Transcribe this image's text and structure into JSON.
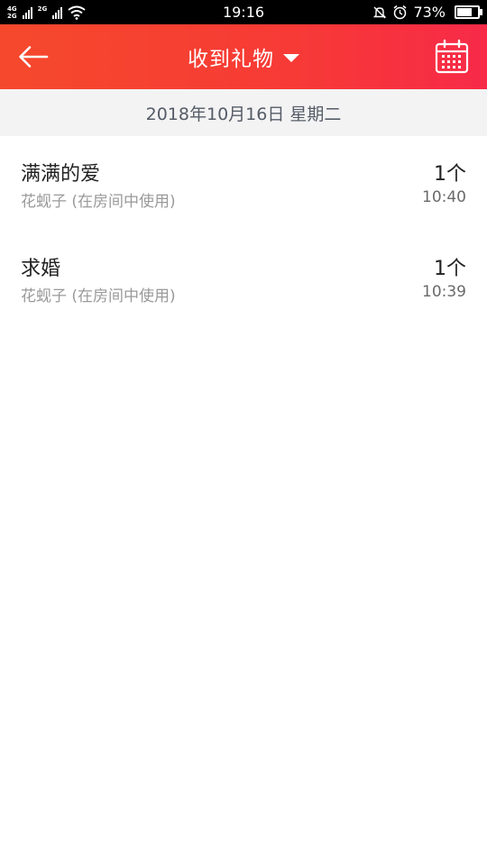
{
  "status_bar": {
    "network_top": "4G",
    "network_bottom": "2G",
    "network_secondary": "2G",
    "time": "19:16",
    "battery_percent_text": "73%",
    "battery_level": 0.73,
    "icons": [
      "signal-icon",
      "wifi-icon",
      "mute-icon",
      "alarm-icon",
      "battery-icon"
    ]
  },
  "header": {
    "title": "收到礼物",
    "icons": [
      "back-arrow-icon",
      "dropdown-caret-icon",
      "calendar-icon"
    ]
  },
  "date_bar": {
    "text": "2018年10月16日 星期二"
  },
  "gifts": [
    {
      "name": "满满的爱",
      "sender": "花蚬子 (在房间中使用)",
      "count": "1个",
      "time": "10:40"
    },
    {
      "name": "求婚",
      "sender": "花蚬子 (在房间中使用)",
      "count": "1个",
      "time": "10:39"
    }
  ],
  "colors": {
    "header_start": "#f5492c",
    "header_end": "#f72a48",
    "date_bar_bg": "#f3f3f4"
  }
}
